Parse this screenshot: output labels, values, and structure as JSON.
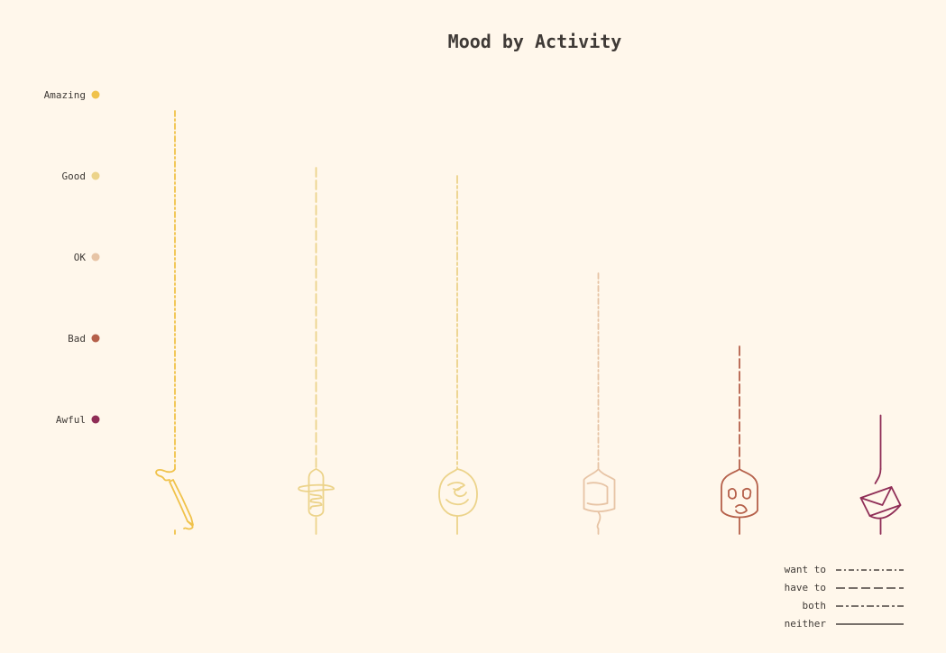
{
  "chart_data": {
    "type": "line",
    "title": "Mood by Activity",
    "xlabel": "",
    "ylabel": "",
    "mood_levels": [
      {
        "label": "Amazing",
        "value": 5,
        "color": "#f0c24a"
      },
      {
        "label": "Good",
        "value": 4,
        "color": "#ecd38a"
      },
      {
        "label": "OK",
        "value": 3,
        "color": "#e7c4a5"
      },
      {
        "label": "Bad",
        "value": 2,
        "color": "#b5604a"
      },
      {
        "label": "Awful",
        "value": 1,
        "color": "#8f2d56"
      }
    ],
    "ylim": [
      0.4,
      5.2
    ],
    "activities": [
      {
        "icon": "pencil-icon",
        "mood": 4.8,
        "color": "#f0c24a",
        "line_style": "want to"
      },
      {
        "icon": "microphone-icon",
        "mood": 4.1,
        "color": "#ecd38a",
        "line_style": "have to"
      },
      {
        "icon": "face-doodle-icon",
        "mood": 4.0,
        "color": "#ecd38a",
        "line_style": "both"
      },
      {
        "icon": "cup-icon",
        "mood": 2.8,
        "color": "#e7c4a5",
        "line_style": "want to"
      },
      {
        "icon": "mask-icon",
        "mood": 1.9,
        "color": "#b5604a",
        "line_style": "have to"
      },
      {
        "icon": "envelope-icon",
        "mood": 1.05,
        "color": "#8f2d56",
        "line_style": "neither"
      }
    ],
    "legend": {
      "position": "bottom-right",
      "items": [
        {
          "label": "want to",
          "dash": "6,3,2,3"
        },
        {
          "label": "have to",
          "dash": "10,4"
        },
        {
          "label": "both",
          "dash": "8,3,3,3"
        },
        {
          "label": "neither",
          "dash": "none"
        }
      ]
    }
  }
}
